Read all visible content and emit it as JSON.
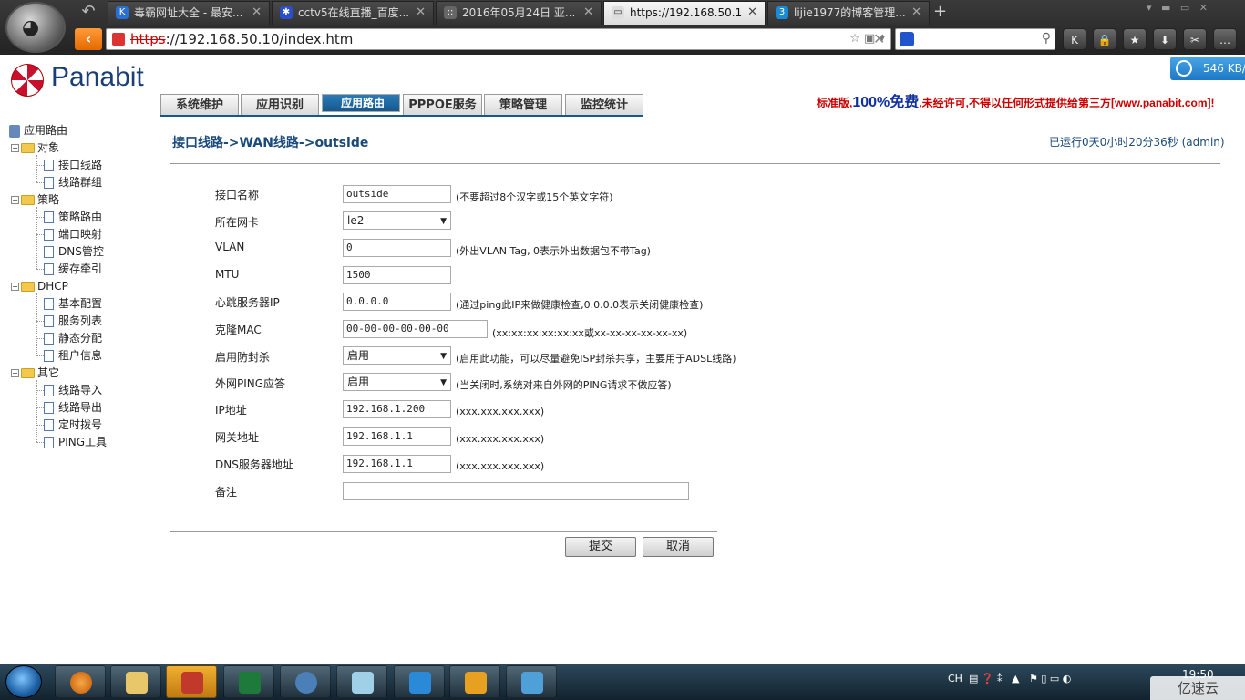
{
  "browser": {
    "tabs": [
      {
        "label": "毒霸网址大全 - 最安...",
        "fav": "K"
      },
      {
        "label": "cctv5在线直播_百度...",
        "fav": "✱"
      },
      {
        "label": "2016年05月24日 亚...",
        "fav": "::"
      },
      {
        "label": "https://192.168.50.1",
        "fav": "▭"
      },
      {
        "label": "lijie1977的博客管理...",
        "fav": "3"
      }
    ],
    "url_scheme": "https",
    "url_rest": "://192.168.50.10/index.htm",
    "toolbar_icons": [
      "K",
      "🔒",
      "★",
      "⬇",
      "✂",
      "…"
    ],
    "badge": "546 KB/"
  },
  "app": {
    "brand": "Panabit",
    "nav_tabs": [
      "系统维护",
      "应用识别",
      "应用路由",
      "PPPOE服务",
      "策略管理",
      "监控统计"
    ],
    "selected_tab": "应用路由",
    "notice_pre": "标准版,",
    "notice_bold": "100%免费",
    "notice_post": ",未经许可,不得以任何形式提供给第三方[www.panabit.com]!"
  },
  "tree": {
    "root": "应用路由",
    "groups": [
      {
        "label": "对象",
        "items": [
          "接口线路",
          "线路群组"
        ]
      },
      {
        "label": "策略",
        "items": [
          "策略路由",
          "端口映射",
          "DNS管控",
          "缓存牵引"
        ]
      },
      {
        "label": "DHCP",
        "items": [
          "基本配置",
          "服务列表",
          "静态分配",
          "租户信息"
        ]
      },
      {
        "label": "其它",
        "items": [
          "线路导入",
          "线路导出",
          "定时拨号",
          "PING工具"
        ]
      }
    ]
  },
  "page": {
    "breadcrumb": "接口线路->WAN线路->outside",
    "uptime": "已运行0天0小时20分36秒 (admin)"
  },
  "form": {
    "name_label": "接口名称",
    "name_value": "outside",
    "name_hint": "(不要超过8个汉字或15个英文字符)",
    "nic_label": "所在网卡",
    "nic_value": "le2",
    "vlan_label": "VLAN",
    "vlan_value": "0",
    "vlan_hint": "(外出VLAN Tag, 0表示外出数据包不带Tag)",
    "mtu_label": "MTU",
    "mtu_value": "1500",
    "hb_label": "心跳服务器IP",
    "hb_value": "0.0.0.0",
    "hb_hint": "(通过ping此IP来做健康检查,0.0.0.0表示关闭健康检查)",
    "mac_label": "克隆MAC",
    "mac_value": "00-00-00-00-00-00",
    "mac_hint": "(xx:xx:xx:xx:xx:xx或xx-xx-xx-xx-xx-xx)",
    "anti_label": "启用防封杀",
    "anti_value": "启用",
    "anti_hint": "(启用此功能，可以尽量避免ISP封杀共享，主要用于ADSL线路)",
    "ping_label": "外网PING应答",
    "ping_value": "启用",
    "ping_hint": "(当关闭时,系统对来自外网的PING请求不做应答)",
    "ip_label": "IP地址",
    "ip_value": "192.168.1.200",
    "ip_hint": "(xxx.xxx.xxx.xxx)",
    "gw_label": "网关地址",
    "gw_value": "192.168.1.1",
    "gw_hint": "(xxx.xxx.xxx.xxx)",
    "dns_label": "DNS服务器地址",
    "dns_value": "192.168.1.1",
    "dns_hint": "(xxx.xxx.xxx.xxx)",
    "note_label": "备注",
    "note_value": "",
    "submit": "提交",
    "cancel": "取消"
  },
  "taskbar": {
    "tray": "CH",
    "clock": "19:50",
    "watermark": "亿速云"
  }
}
